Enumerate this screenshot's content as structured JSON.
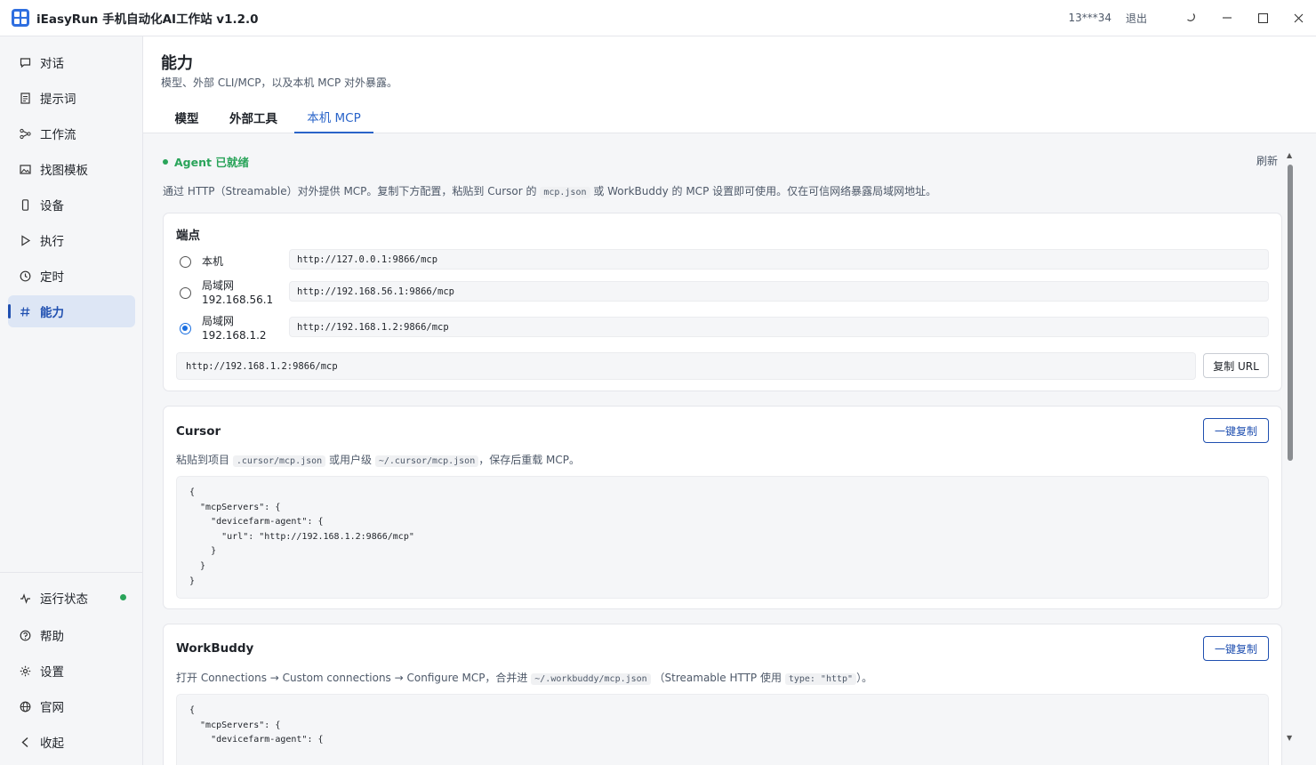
{
  "window": {
    "title": "iEasyRun 手机自动化AI工作站 v1.2.0",
    "user": "13***34",
    "logout": "退出"
  },
  "sidebar": {
    "items": [
      {
        "label": "对话",
        "icon": "chat-icon"
      },
      {
        "label": "提示词",
        "icon": "document-icon"
      },
      {
        "label": "工作流",
        "icon": "workflow-icon"
      },
      {
        "label": "找图模板",
        "icon": "image-icon"
      },
      {
        "label": "设备",
        "icon": "phone-icon"
      },
      {
        "label": "执行",
        "icon": "play-icon"
      },
      {
        "label": "定时",
        "icon": "clock-icon"
      },
      {
        "label": "能力",
        "icon": "hash-icon",
        "active": true
      }
    ],
    "bottom": [
      {
        "label": "运行状态",
        "icon": "activity-icon"
      },
      {
        "label": "帮助",
        "icon": "help-icon"
      },
      {
        "label": "设置",
        "icon": "gear-icon"
      },
      {
        "label": "官网",
        "icon": "globe-icon"
      },
      {
        "label": "收起",
        "icon": "chevron-left-icon"
      }
    ]
  },
  "page": {
    "title": "能力",
    "subtitle": "模型、外部 CLI/MCP，以及本机 MCP 对外暴露。",
    "tabs": [
      "模型",
      "外部工具",
      "本机 MCP"
    ],
    "active_tab": "本机 MCP"
  },
  "mcp": {
    "status": "Agent 已就绪",
    "refresh": "刷新",
    "desc_pre": "通过 HTTP（Streamable）对外提供 MCP。复制下方配置，粘贴到 Cursor 的",
    "desc_code": "mcp.json",
    "desc_post": "或 WorkBuddy 的 MCP 设置即可使用。仅在可信网络暴露局域网地址。",
    "endpoints": {
      "title": "端点",
      "options": [
        {
          "label": "本机",
          "sublabel": "",
          "url": "http://127.0.0.1:9866/mcp",
          "checked": false
        },
        {
          "label": "局域网",
          "sublabel": "192.168.56.1",
          "url": "http://192.168.56.1:9866/mcp",
          "checked": false
        },
        {
          "label": "局域网",
          "sublabel": "192.168.1.2",
          "url": "http://192.168.1.2:9866/mcp",
          "checked": true
        }
      ],
      "selected_url": "http://192.168.1.2:9866/mcp",
      "copy_url": "复制 URL"
    },
    "cursor": {
      "title": "Cursor",
      "copy": "一键复制",
      "desc_pre": "粘贴到项目",
      "code1": ".cursor/mcp.json",
      "desc_mid": "或用户级",
      "code2": "~/.cursor/mcp.json",
      "desc_post": "，保存后重载 MCP。",
      "config": "{\n  \"mcpServers\": {\n    \"devicefarm-agent\": {\n      \"url\": \"http://192.168.1.2:9866/mcp\"\n    }\n  }\n}"
    },
    "workbuddy": {
      "title": "WorkBuddy",
      "copy": "一键复制",
      "desc_pre": "打开 Connections → Custom connections → Configure MCP，合并进",
      "code1": "~/.workbuddy/mcp.json",
      "desc_mid": "（Streamable HTTP 使用",
      "code2": "type: \"http\"",
      "desc_post": "）。",
      "config": "{\n  \"mcpServers\": {\n    \"devicefarm-agent\": {"
    }
  },
  "colors": {
    "accent": "#2a64c9",
    "ok": "#2aa45a"
  }
}
